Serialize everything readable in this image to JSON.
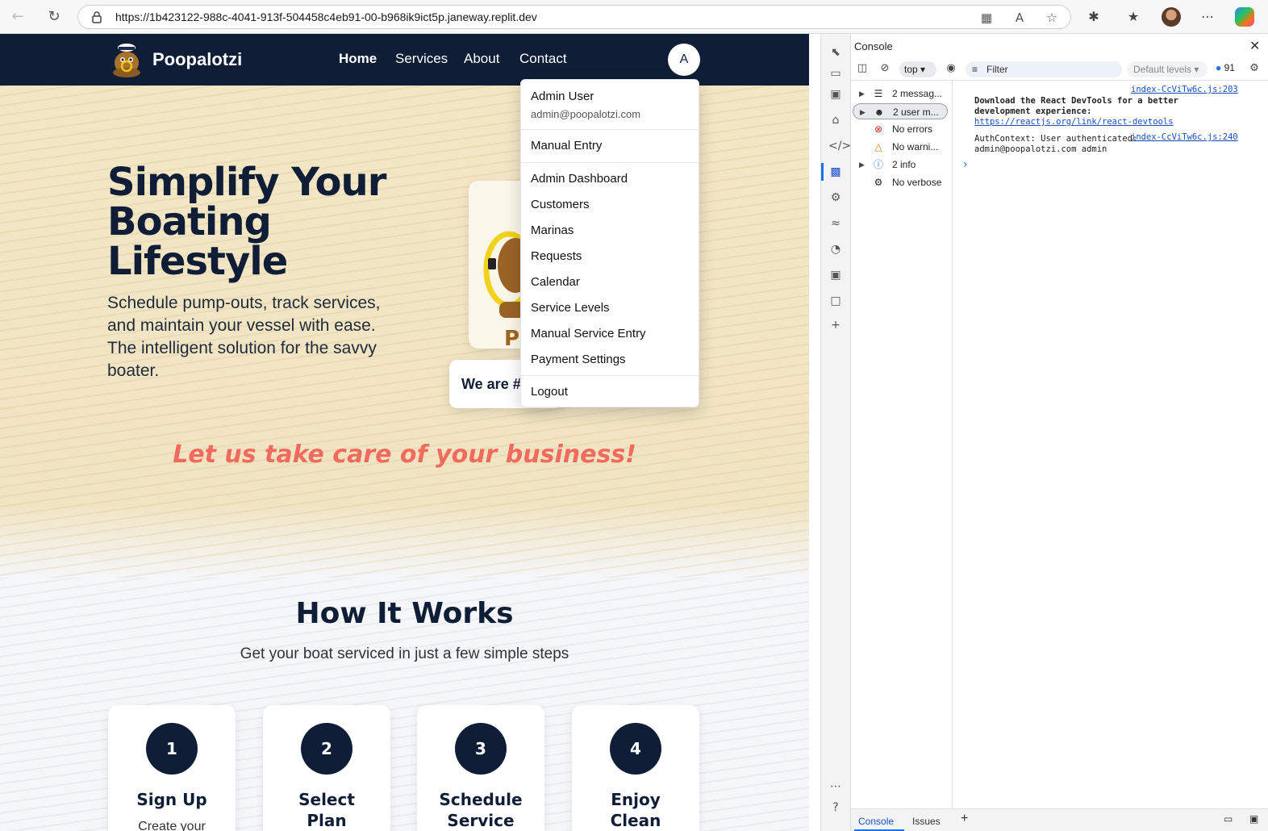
{
  "browser": {
    "url": "https://1b423122-988c-4041-913f-504458c4eb91-00-b968ik9ict5p.janeway.replit.dev"
  },
  "site": {
    "brand": "Poopalotzi",
    "nav": [
      "Home",
      "Services",
      "About",
      "Contact"
    ],
    "user_initial": "A"
  },
  "hero": {
    "title": "Simplify Your Boating Lifestyle",
    "subtitle": "Schedule pump-outs, track services, and maintain your vessel with ease. The intelligent solution for the savvy boater.",
    "badge": "We are #",
    "tagline": "Let us take care of your business!"
  },
  "how": {
    "title": "How It Works",
    "subtitle": "Get your boat serviced in just a few simple steps",
    "steps": [
      {
        "num": "1",
        "title": "Sign Up",
        "desc": "Create your"
      },
      {
        "num": "2",
        "title": "Select Plan",
        "desc": ""
      },
      {
        "num": "3",
        "title": "Schedule Service",
        "desc": ""
      },
      {
        "num": "4",
        "title": "Enjoy Clean",
        "desc": ""
      }
    ]
  },
  "user_menu": {
    "name": "Admin User",
    "email": "admin@poopalotzi.com",
    "items": [
      "Manual Entry",
      "Admin Dashboard",
      "Customers",
      "Marinas",
      "Requests",
      "Calendar",
      "Service Levels",
      "Manual Service Entry",
      "Payment Settings",
      "Logout"
    ]
  },
  "devtools": {
    "panel_title": "Console",
    "context": "top",
    "filter_placeholder": "Filter",
    "levels": "Default levels",
    "message_count": "91",
    "sidebar": [
      "2 messag...",
      "2 user m...",
      "No errors",
      "No warni...",
      "2 info",
      "No verbose"
    ],
    "logs": [
      {
        "source": "index-CcViTw6c.js:203",
        "text": "Download the React DevTools for a better development experience:",
        "link": "https://reactjs.org/link/react-devtools"
      },
      {
        "source": "index-CcViTw6c.js:240",
        "text": "AuthContext: User authenticated: admin@poopalotzi.com admin"
      }
    ],
    "bottom_tabs": [
      "Console",
      "Issues"
    ]
  }
}
